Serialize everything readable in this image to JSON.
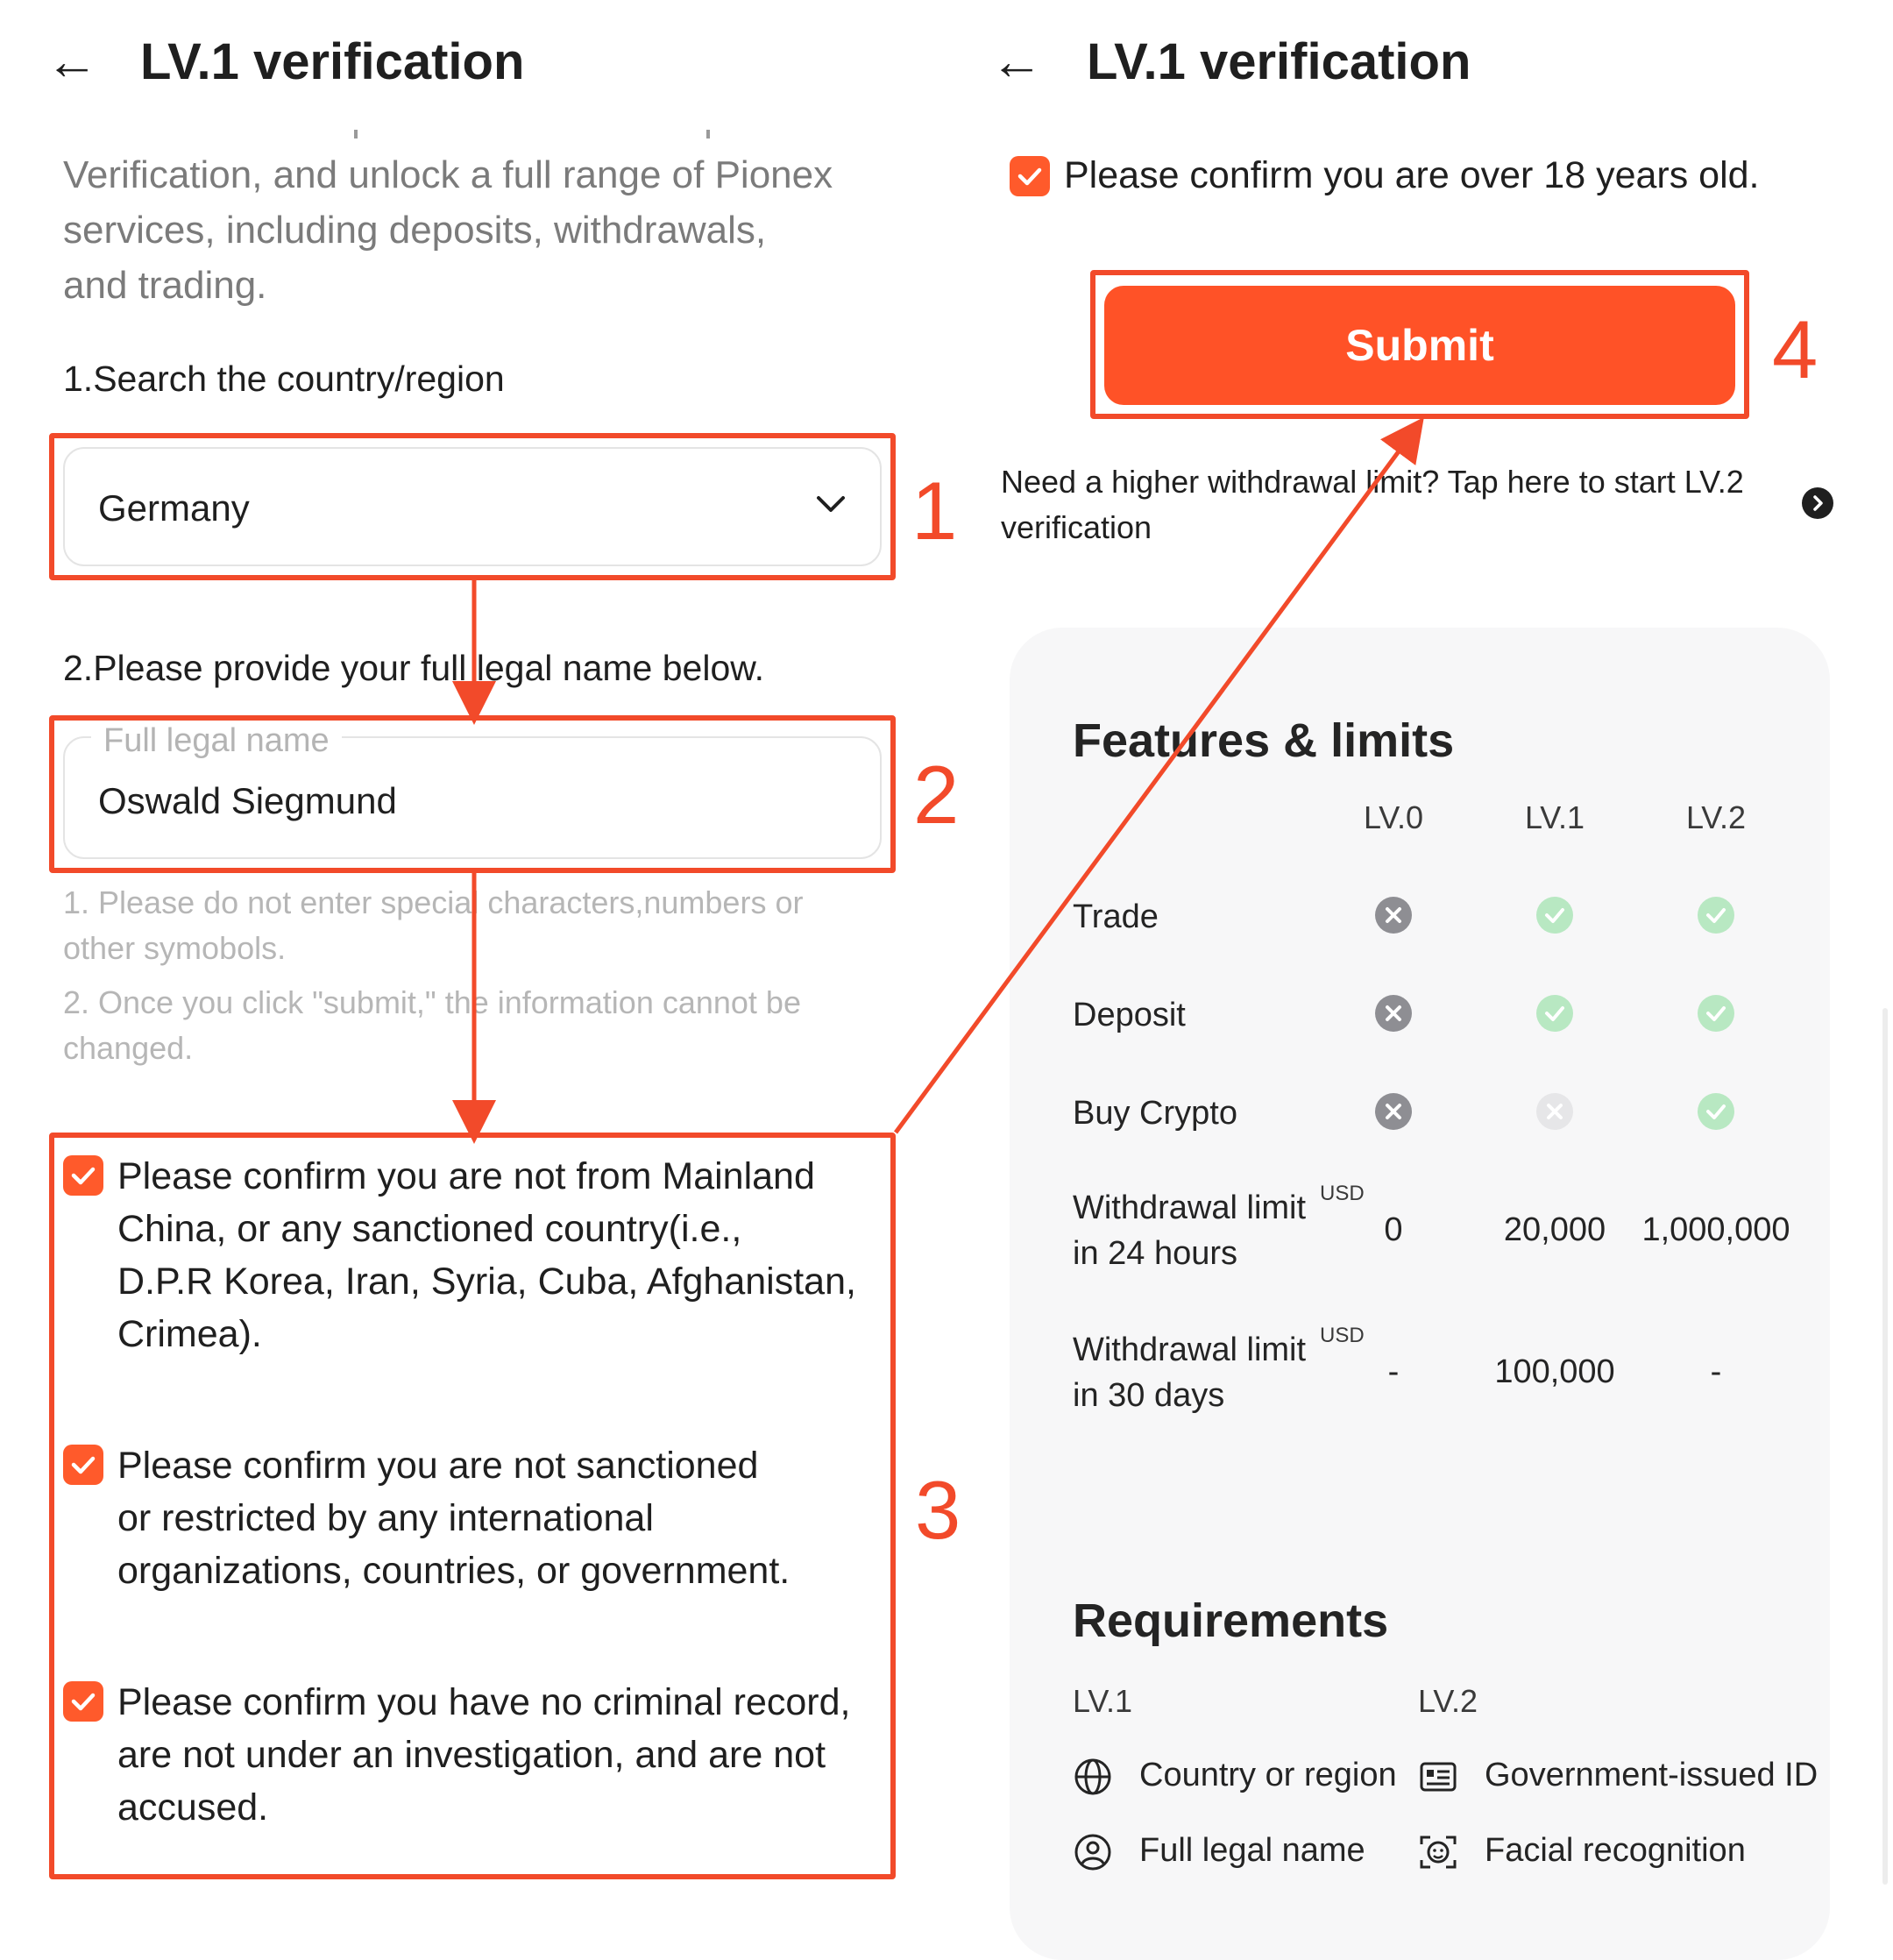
{
  "left": {
    "back_glyph": "←",
    "title": "LV.1 verification",
    "intro_lines": [
      "Verification, and unlock a full range of Pionex",
      "services, including deposits, withdrawals,",
      "and trading."
    ],
    "step1_label": "1.Search the country/region",
    "country_value": "Germany",
    "step2_label": "2.Please provide your full legal name below.",
    "name_label": "Full legal name",
    "name_value": "Oswald Siegmund",
    "hints": [
      [
        "1. Please do not enter special characters,numbers or",
        "other symobols."
      ],
      [
        "2. Once you click \"submit,\" the information cannot be",
        "changed."
      ]
    ],
    "confirms": [
      [
        "Please confirm you are not from Mainland",
        "China, or any sanctioned country(i.e.,",
        "D.P.R Korea, Iran, Syria, Cuba, Afghanistan,",
        "Crimea)."
      ],
      [
        "Please confirm you are not sanctioned",
        "or restricted by any international",
        "organizations, countries, or government."
      ],
      [
        "Please confirm you have no criminal record,",
        "are not under an investigation, and are not",
        "accused."
      ]
    ]
  },
  "annotations": {
    "n1": "1",
    "n2": "2",
    "n3": "3",
    "n4": "4",
    "color": "#f24a2a"
  },
  "right": {
    "back_glyph": "←",
    "title": "LV.1 verification",
    "age_confirm": "Please confirm you are over 18 years old.",
    "submit_label": "Submit",
    "lv2_link_lines": [
      "Need a higher withdrawal limit? Tap here to start LV.2",
      "verification"
    ],
    "features_title": "Features & limits",
    "levels": [
      "LV.0",
      "LV.1",
      "LV.2"
    ],
    "rows": [
      {
        "label": "Trade",
        "status": [
          "no",
          "yes",
          "yes"
        ]
      },
      {
        "label": "Deposit",
        "status": [
          "no",
          "yes",
          "yes"
        ]
      },
      {
        "label": "Buy Crypto",
        "status": [
          "no",
          "no-light",
          "yes"
        ]
      }
    ],
    "limits": [
      {
        "label_lines": [
          "Withdrawal limit",
          "in 24 hours"
        ],
        "unit": "USD",
        "values": [
          "0",
          "20,000",
          "1,000,000"
        ]
      },
      {
        "label_lines": [
          "Withdrawal limit",
          "in 30 days"
        ],
        "unit": "USD",
        "values": [
          "-",
          "100,000",
          "-"
        ]
      }
    ],
    "requirements_title": "Requirements",
    "req_cols": [
      "LV.1",
      "LV.2"
    ],
    "req_items": [
      {
        "icon": "globe-icon",
        "text": "Country or region"
      },
      {
        "icon": "id-card-icon",
        "text": "Government-issued ID"
      },
      {
        "icon": "user-icon",
        "text": "Full legal name"
      },
      {
        "icon": "face-scan-icon",
        "text": "Facial recognition"
      }
    ]
  },
  "colors": {
    "accent": "#ff5227",
    "check_green": "#b8e8c2",
    "cross_gray": "#8e8e93"
  }
}
